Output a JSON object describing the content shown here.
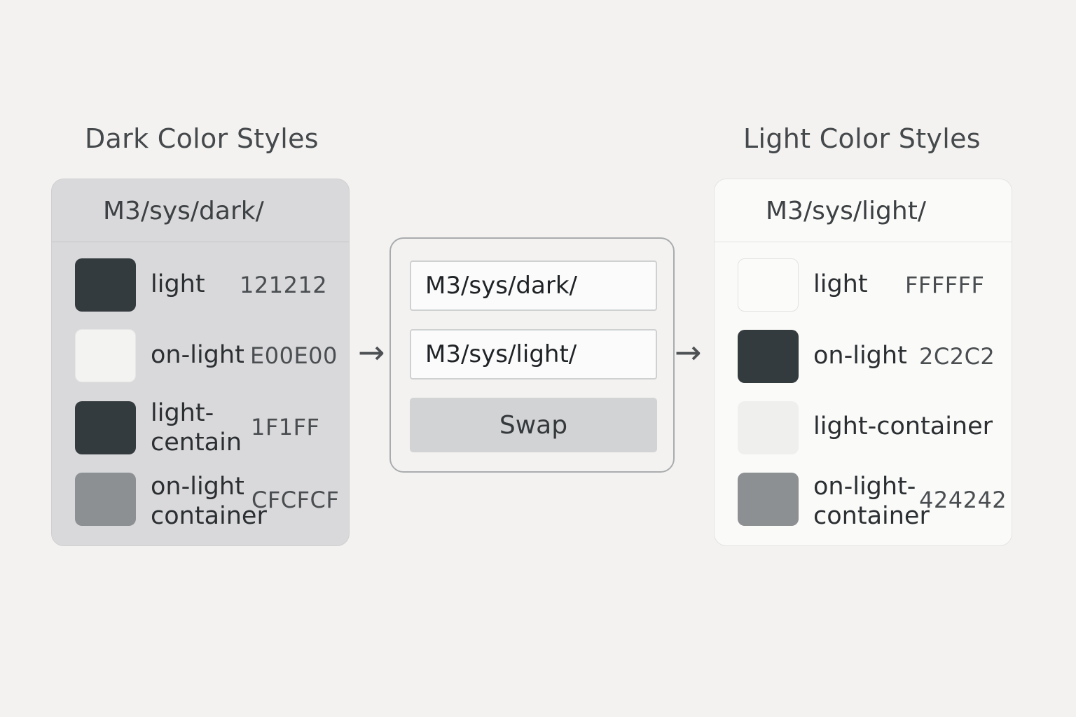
{
  "dark": {
    "title": "Dark Color Styles",
    "prefix": "M3/sys/dark/",
    "rows": [
      {
        "label_lines": [
          "light"
        ],
        "value": "121212",
        "swatch_color": "#343b3e"
      },
      {
        "label_lines": [
          "on-light"
        ],
        "value": "E00E00",
        "swatch_color": "#f3f3f2"
      },
      {
        "label_lines": [
          "light-",
          "centain"
        ],
        "value": "1F1FF",
        "swatch_color": "#343b3e"
      },
      {
        "label_lines": [
          "on-light",
          "container"
        ],
        "value": "CFCFCF",
        "swatch_color": "#8d9092"
      }
    ]
  },
  "swap": {
    "source_value": "M3/sys/dark/",
    "target_value": "M3/sys/light/",
    "button_label": "Swap"
  },
  "arrows": {
    "left": "→",
    "right": "→"
  },
  "light": {
    "title": "Light Color Styles",
    "prefix": "M3/sys/light/",
    "rows": [
      {
        "label_lines": [
          "light"
        ],
        "value": "FFFFFF",
        "swatch_color": "#fbfbfa"
      },
      {
        "label_lines": [
          "on-light"
        ],
        "value": "2C2C2",
        "swatch_color": "#343b3e"
      },
      {
        "label_lines": [
          "light-container"
        ],
        "value": "",
        "swatch_color": "#efefee"
      },
      {
        "label_lines": [
          "on-light-",
          "container"
        ],
        "value": "424242",
        "swatch_color": "#8d9092"
      }
    ]
  }
}
